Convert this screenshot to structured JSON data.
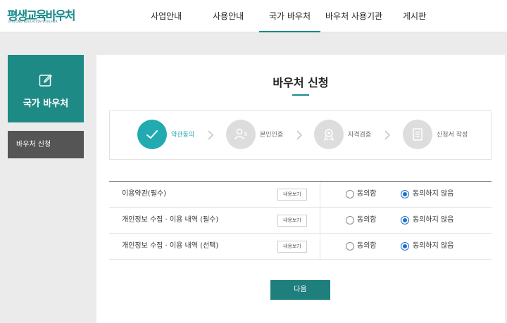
{
  "logo": {
    "main": "평생교육바우처",
    "sub": "LIFELONG EDUCATION VOUCHER"
  },
  "nav": [
    {
      "label": "사업안내"
    },
    {
      "label": "사용안내"
    },
    {
      "label": "국가 바우처"
    },
    {
      "label": "바우처 사용기관"
    },
    {
      "label": "게시판"
    }
  ],
  "sidebar": {
    "banner_title": "국가 바우처",
    "menu_item": "바우처 신청"
  },
  "page_title": "바우처 신청",
  "steps": [
    {
      "label": "약관동의"
    },
    {
      "label": "본인인증"
    },
    {
      "label": "자격검증"
    },
    {
      "label": "신청서 작성"
    }
  ],
  "terms": {
    "view_label": "내용보기",
    "agree_label": "동의함",
    "disagree_label": "동의하지 않음",
    "rows": [
      {
        "name": "이용약관(필수)"
      },
      {
        "name": "개인정보 수집 · 이용 내역 (필수)"
      },
      {
        "name": "개인정보 수집 · 이용 내역 (선택)"
      }
    ]
  },
  "next_button": "다음",
  "colors": {
    "accent": "#1a8a8a",
    "step_active": "#21aab0",
    "radio": "#1a6fd1"
  }
}
